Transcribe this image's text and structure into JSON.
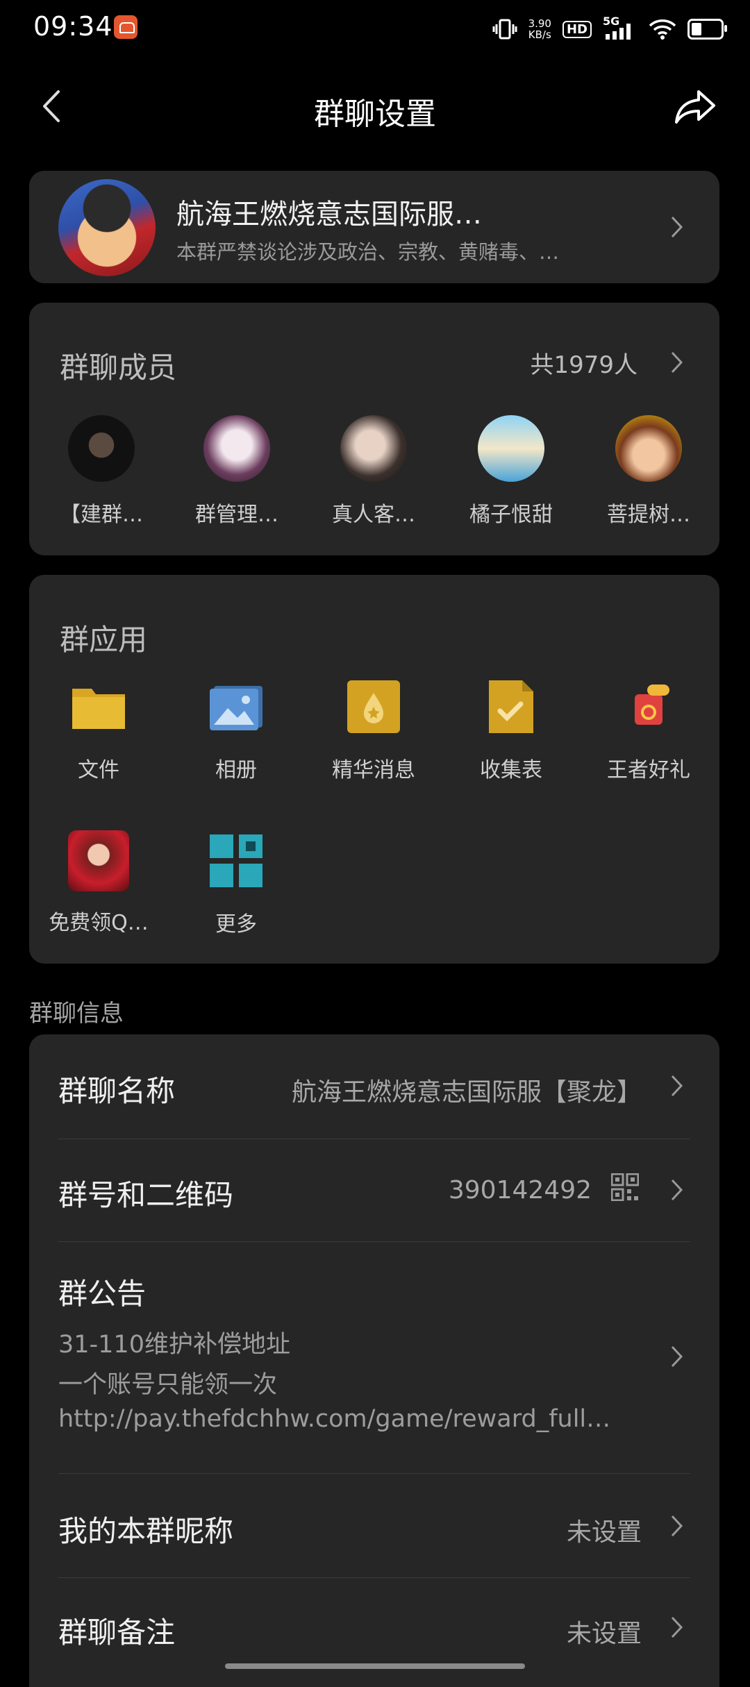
{
  "status_bar": {
    "time": "09:34",
    "net_speed_value": "3.90",
    "net_speed_unit": "KB/s",
    "hd_label": "HD",
    "network_label": "5G"
  },
  "nav": {
    "title": "群聊设置"
  },
  "group": {
    "name": "航海王燃烧意志国际服…",
    "description": "本群严禁谈论涉及政治、宗教、黄赌毒、…"
  },
  "members": {
    "title": "群聊成员",
    "count": "共1979人",
    "items": [
      {
        "name": "【建群…"
      },
      {
        "name": "群管理…"
      },
      {
        "name": "真人客…"
      },
      {
        "name": "橘子恨甜"
      },
      {
        "name": "菩提树…"
      }
    ]
  },
  "apps": {
    "title": "群应用",
    "items": [
      {
        "label": "文件",
        "icon": "folder-icon"
      },
      {
        "label": "相册",
        "icon": "photo-album-icon"
      },
      {
        "label": "精华消息",
        "icon": "essence-message-icon"
      },
      {
        "label": "收集表",
        "icon": "collection-form-icon"
      },
      {
        "label": "王者好礼",
        "icon": "gift-icon"
      },
      {
        "label": "免费领Q…",
        "icon": "promo-avatar-icon"
      },
      {
        "label": "更多",
        "icon": "more-grid-icon"
      }
    ]
  },
  "info": {
    "section_label": "群聊信息",
    "group_name_label": "群聊名称",
    "group_name_value": "航海王燃烧意志国际服【聚龙】",
    "group_id_label": "群号和二维码",
    "group_id_value": "390142492",
    "notice_label": "群公告",
    "notice_lines": [
      "31-110维护补偿地址",
      "一个账号只能领一次",
      "http://pay.thefdchhw.com/game/reward_full…"
    ],
    "nickname_label": "我的本群昵称",
    "nickname_value": "未设置",
    "remark_label": "群聊备注",
    "remark_value": "未设置"
  }
}
